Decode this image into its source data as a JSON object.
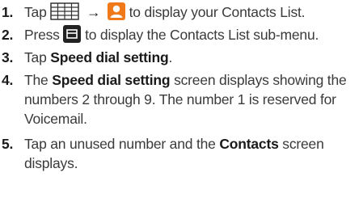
{
  "steps": [
    {
      "number": "1.",
      "text_a": "Tap",
      "text_b": "to display your Contacts List."
    },
    {
      "number": "2.",
      "text_a": "Press",
      "text_b": "to display the Contacts List sub-menu."
    },
    {
      "number": "3.",
      "text_a": "Tap",
      "bold": "Speed dial setting",
      "text_b": "."
    },
    {
      "number": "4.",
      "text_a": "The",
      "bold": "Speed dial setting",
      "text_b": "screen displays showing the",
      "line2": "numbers 2 through 9. The number 1 is reserved for",
      "line3": "Voicemail."
    },
    {
      "number": "5.",
      "text_a": "Tap an unused number and the",
      "bold": "Contacts",
      "text_b": "screen",
      "line2": "displays."
    }
  ],
  "arrow": "→",
  "icons": [
    "apps-grid-icon",
    "contacts-icon",
    "menu-key-icon"
  ],
  "colors": {
    "contacts_icon": "#f07a1a",
    "menu_key": "#222222",
    "grid_stroke": "#333333"
  }
}
